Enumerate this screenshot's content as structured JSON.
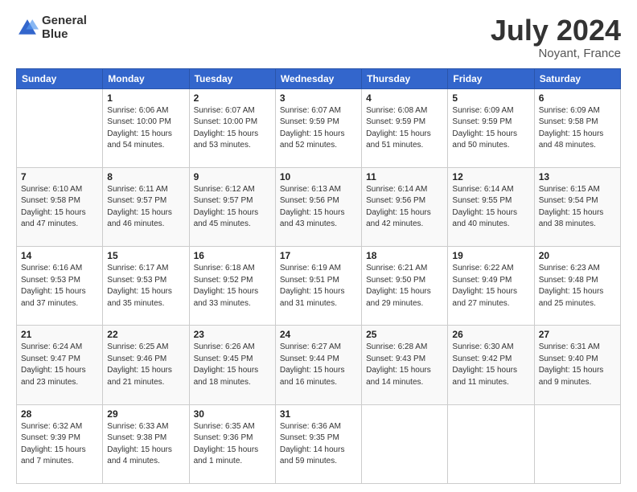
{
  "logo": {
    "line1": "General",
    "line2": "Blue"
  },
  "title": "July 2024",
  "location": "Noyant, France",
  "days_header": [
    "Sunday",
    "Monday",
    "Tuesday",
    "Wednesday",
    "Thursday",
    "Friday",
    "Saturday"
  ],
  "weeks": [
    [
      {
        "day": "",
        "info": ""
      },
      {
        "day": "1",
        "info": "Sunrise: 6:06 AM\nSunset: 10:00 PM\nDaylight: 15 hours\nand 54 minutes."
      },
      {
        "day": "2",
        "info": "Sunrise: 6:07 AM\nSunset: 10:00 PM\nDaylight: 15 hours\nand 53 minutes."
      },
      {
        "day": "3",
        "info": "Sunrise: 6:07 AM\nSunset: 9:59 PM\nDaylight: 15 hours\nand 52 minutes."
      },
      {
        "day": "4",
        "info": "Sunrise: 6:08 AM\nSunset: 9:59 PM\nDaylight: 15 hours\nand 51 minutes."
      },
      {
        "day": "5",
        "info": "Sunrise: 6:09 AM\nSunset: 9:59 PM\nDaylight: 15 hours\nand 50 minutes."
      },
      {
        "day": "6",
        "info": "Sunrise: 6:09 AM\nSunset: 9:58 PM\nDaylight: 15 hours\nand 48 minutes."
      }
    ],
    [
      {
        "day": "7",
        "info": "Sunrise: 6:10 AM\nSunset: 9:58 PM\nDaylight: 15 hours\nand 47 minutes."
      },
      {
        "day": "8",
        "info": "Sunrise: 6:11 AM\nSunset: 9:57 PM\nDaylight: 15 hours\nand 46 minutes."
      },
      {
        "day": "9",
        "info": "Sunrise: 6:12 AM\nSunset: 9:57 PM\nDaylight: 15 hours\nand 45 minutes."
      },
      {
        "day": "10",
        "info": "Sunrise: 6:13 AM\nSunset: 9:56 PM\nDaylight: 15 hours\nand 43 minutes."
      },
      {
        "day": "11",
        "info": "Sunrise: 6:14 AM\nSunset: 9:56 PM\nDaylight: 15 hours\nand 42 minutes."
      },
      {
        "day": "12",
        "info": "Sunrise: 6:14 AM\nSunset: 9:55 PM\nDaylight: 15 hours\nand 40 minutes."
      },
      {
        "day": "13",
        "info": "Sunrise: 6:15 AM\nSunset: 9:54 PM\nDaylight: 15 hours\nand 38 minutes."
      }
    ],
    [
      {
        "day": "14",
        "info": "Sunrise: 6:16 AM\nSunset: 9:53 PM\nDaylight: 15 hours\nand 37 minutes."
      },
      {
        "day": "15",
        "info": "Sunrise: 6:17 AM\nSunset: 9:53 PM\nDaylight: 15 hours\nand 35 minutes."
      },
      {
        "day": "16",
        "info": "Sunrise: 6:18 AM\nSunset: 9:52 PM\nDaylight: 15 hours\nand 33 minutes."
      },
      {
        "day": "17",
        "info": "Sunrise: 6:19 AM\nSunset: 9:51 PM\nDaylight: 15 hours\nand 31 minutes."
      },
      {
        "day": "18",
        "info": "Sunrise: 6:21 AM\nSunset: 9:50 PM\nDaylight: 15 hours\nand 29 minutes."
      },
      {
        "day": "19",
        "info": "Sunrise: 6:22 AM\nSunset: 9:49 PM\nDaylight: 15 hours\nand 27 minutes."
      },
      {
        "day": "20",
        "info": "Sunrise: 6:23 AM\nSunset: 9:48 PM\nDaylight: 15 hours\nand 25 minutes."
      }
    ],
    [
      {
        "day": "21",
        "info": "Sunrise: 6:24 AM\nSunset: 9:47 PM\nDaylight: 15 hours\nand 23 minutes."
      },
      {
        "day": "22",
        "info": "Sunrise: 6:25 AM\nSunset: 9:46 PM\nDaylight: 15 hours\nand 21 minutes."
      },
      {
        "day": "23",
        "info": "Sunrise: 6:26 AM\nSunset: 9:45 PM\nDaylight: 15 hours\nand 18 minutes."
      },
      {
        "day": "24",
        "info": "Sunrise: 6:27 AM\nSunset: 9:44 PM\nDaylight: 15 hours\nand 16 minutes."
      },
      {
        "day": "25",
        "info": "Sunrise: 6:28 AM\nSunset: 9:43 PM\nDaylight: 15 hours\nand 14 minutes."
      },
      {
        "day": "26",
        "info": "Sunrise: 6:30 AM\nSunset: 9:42 PM\nDaylight: 15 hours\nand 11 minutes."
      },
      {
        "day": "27",
        "info": "Sunrise: 6:31 AM\nSunset: 9:40 PM\nDaylight: 15 hours\nand 9 minutes."
      }
    ],
    [
      {
        "day": "28",
        "info": "Sunrise: 6:32 AM\nSunset: 9:39 PM\nDaylight: 15 hours\nand 7 minutes."
      },
      {
        "day": "29",
        "info": "Sunrise: 6:33 AM\nSunset: 9:38 PM\nDaylight: 15 hours\nand 4 minutes."
      },
      {
        "day": "30",
        "info": "Sunrise: 6:35 AM\nSunset: 9:36 PM\nDaylight: 15 hours\nand 1 minute."
      },
      {
        "day": "31",
        "info": "Sunrise: 6:36 AM\nSunset: 9:35 PM\nDaylight: 14 hours\nand 59 minutes."
      },
      {
        "day": "",
        "info": ""
      },
      {
        "day": "",
        "info": ""
      },
      {
        "day": "",
        "info": ""
      }
    ]
  ]
}
